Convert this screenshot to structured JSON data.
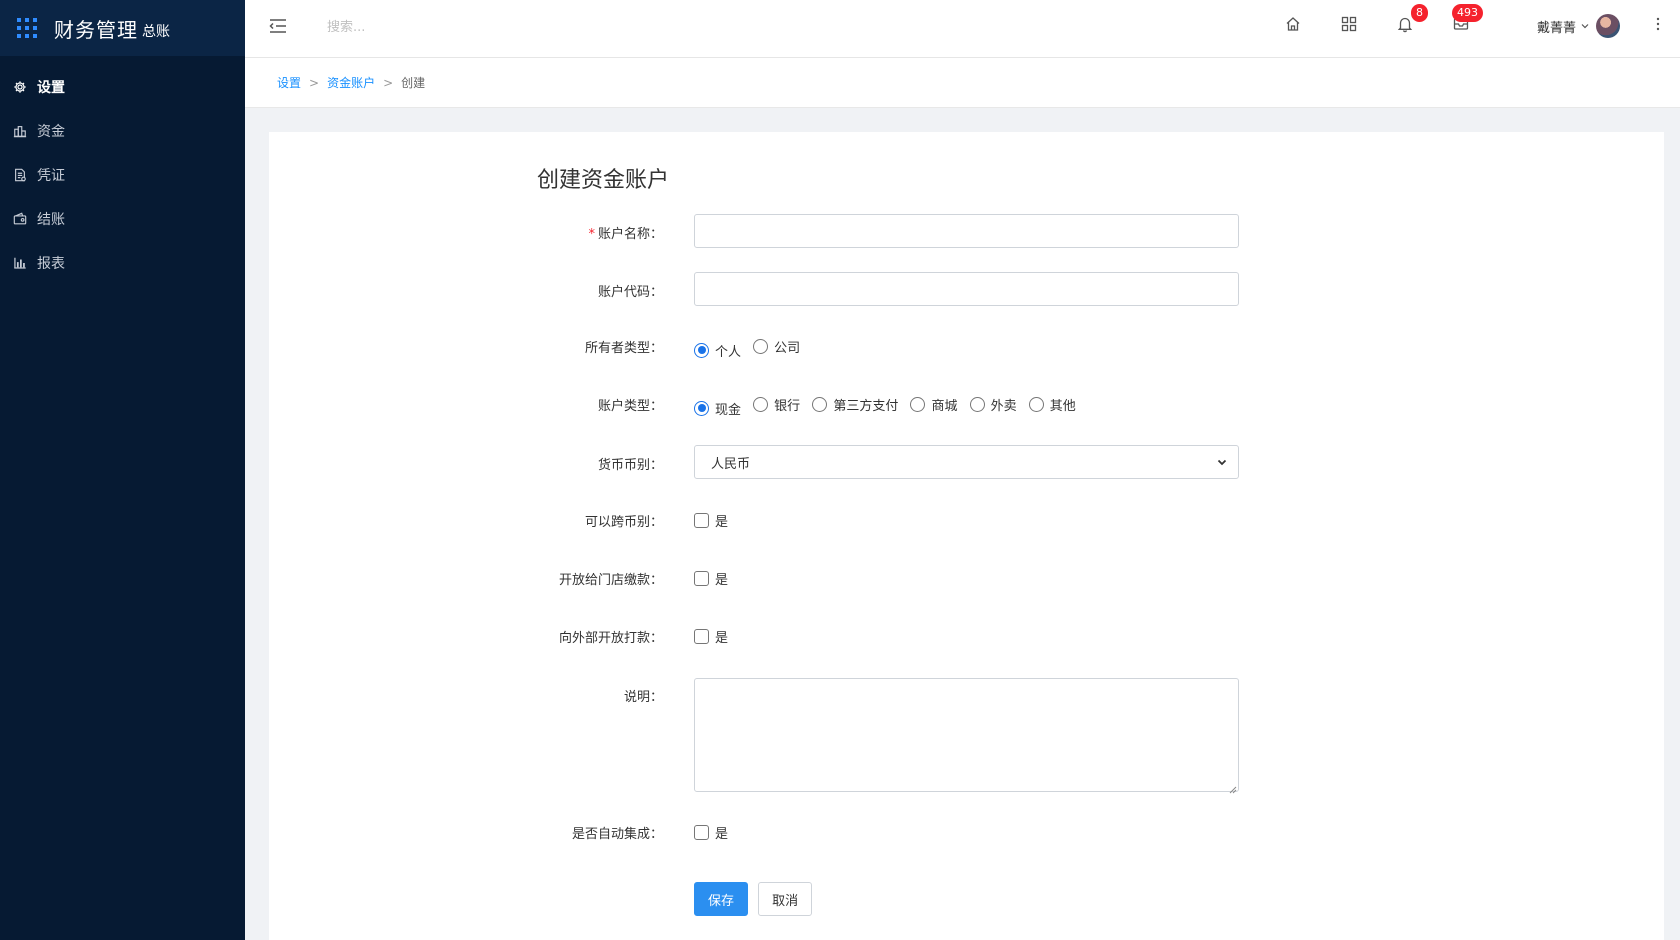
{
  "brand": {
    "title": "财务管理",
    "subtitle": "总账"
  },
  "sidebar": {
    "items": [
      {
        "label": "设置",
        "icon": "gear-icon",
        "active": true
      },
      {
        "label": "资金",
        "icon": "funds-icon",
        "active": false
      },
      {
        "label": "凭证",
        "icon": "voucher-icon",
        "active": false
      },
      {
        "label": "结账",
        "icon": "wallet-icon",
        "active": false
      },
      {
        "label": "报表",
        "icon": "bar-chart-icon",
        "active": false
      }
    ]
  },
  "topbar": {
    "search_placeholder": "搜索...",
    "notifications_count": "8",
    "messages_count": "493",
    "user_name": "戴菁菁"
  },
  "breadcrumb": {
    "items": [
      "设置",
      "资金账户"
    ],
    "current": "创建"
  },
  "form": {
    "title": "创建资金账户",
    "account_name_label": "账户名称：",
    "account_name_value": "",
    "account_code_label": "账户代码：",
    "account_code_value": "",
    "owner_type_label": "所有者类型：",
    "owner_type_options": [
      "个人",
      "公司"
    ],
    "owner_type_selected": 0,
    "account_type_label": "账户类型：",
    "account_type_options": [
      "现金",
      "银行",
      "第三方支付",
      "商城",
      "外卖",
      "其他"
    ],
    "account_type_selected": 0,
    "currency_label": "货币币别：",
    "currency_value": "人民币",
    "cross_currency_label": "可以跨币别：",
    "store_payment_label": "开放给门店缴款：",
    "external_payment_label": "向外部开放打款：",
    "description_label": "说明：",
    "description_value": "",
    "auto_integrate_label": "是否自动集成：",
    "yes_label": "是",
    "save_label": "保存",
    "cancel_label": "取消"
  },
  "colors": {
    "sidebar_bg": "#061a33",
    "primary": "#2b8ff0",
    "badge": "#f5222d"
  }
}
